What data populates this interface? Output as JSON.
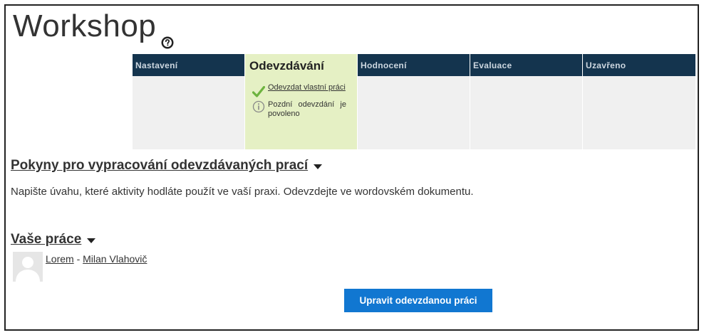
{
  "page": {
    "title": "Workshop"
  },
  "phases": [
    {
      "label": "Nastavení"
    },
    {
      "label": "Odevzdávání",
      "tasks": [
        {
          "icon": "checkmark-icon",
          "text": "Odevzdat vlastní práci"
        },
        {
          "icon": "info-icon",
          "text": "Pozdní odevzdání je povoleno"
        }
      ]
    },
    {
      "label": "Hodnocení"
    },
    {
      "label": "Evaluace"
    },
    {
      "label": "Uzavřeno"
    }
  ],
  "instructions": {
    "heading": "Pokyny pro vypracování odevzdávaných prací",
    "text": "Napište úvahu, které aktivity hodláte použít ve vaší praxi. Odevzdejte ve wordovském dokumentu."
  },
  "submission": {
    "heading": "Vaše práce",
    "title": "Lorem",
    "separator": " - ",
    "author": "Milan Vlahovič",
    "edit_button": "Upravit odevzdanou práci"
  },
  "colors": {
    "phase_header": "#14344e",
    "active_phase": "#e5f0c4",
    "button": "#1177d1",
    "check": "#6db33f"
  }
}
